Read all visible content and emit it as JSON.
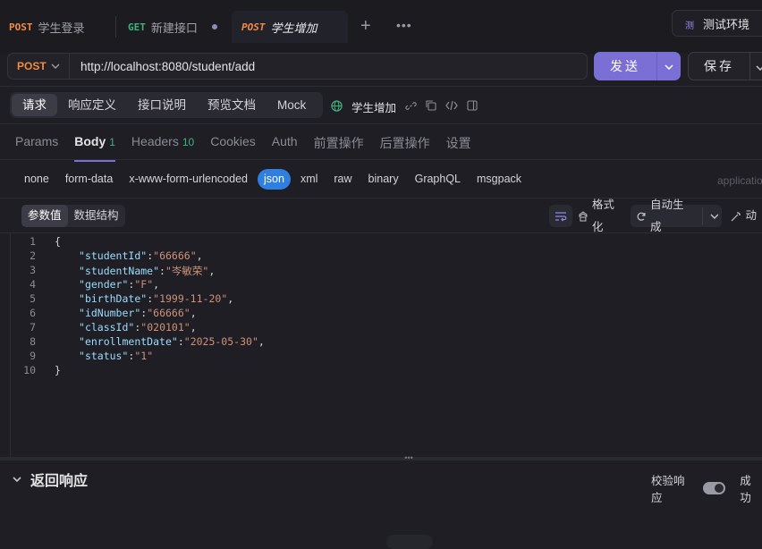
{
  "tabs": [
    {
      "method": "POST",
      "name": "学生登录"
    },
    {
      "method": "GET",
      "name": "新建接口"
    },
    {
      "method": "POST",
      "name": "学生增加"
    }
  ],
  "tab_new_icon": "plus-icon",
  "tab_more_icon": "ellipsis-icon",
  "environment": {
    "badge": "测",
    "label": "测试环境"
  },
  "request": {
    "method": "POST",
    "url": "http://localhost:8080/student/add",
    "send_label": "发送",
    "save_label": "保存"
  },
  "subnav": [
    "请求",
    "响应定义",
    "接口说明",
    "预览文档",
    "Mock"
  ],
  "api_name": "学生增加",
  "param_tabs": [
    {
      "label": "Params",
      "count": ""
    },
    {
      "label": "Body",
      "count": "1"
    },
    {
      "label": "Headers",
      "count": "10"
    },
    {
      "label": "Cookies",
      "count": ""
    },
    {
      "label": "Auth",
      "count": ""
    },
    {
      "label": "前置操作",
      "count": ""
    },
    {
      "label": "后置操作",
      "count": ""
    },
    {
      "label": "设置",
      "count": ""
    }
  ],
  "body_types": [
    "none",
    "form-data",
    "x-www-form-urlencoded",
    "json",
    "xml",
    "raw",
    "binary",
    "GraphQL",
    "msgpack"
  ],
  "active_body_type": "json",
  "content_type": "applicatio",
  "view_toggle": [
    "参数值",
    "数据结构"
  ],
  "toolbar": {
    "format": "格式化",
    "autogen": "自动生成",
    "extra": "动"
  },
  "code": {
    "open": "{",
    "close": "}",
    "fields": [
      {
        "key": "studentId",
        "value": "66666"
      },
      {
        "key": "studentName",
        "value": "岑敏荣"
      },
      {
        "key": "gender",
        "value": "F"
      },
      {
        "key": "birthDate",
        "value": "1999-11-20"
      },
      {
        "key": "idNumber",
        "value": "66666"
      },
      {
        "key": "classId",
        "value": "020101"
      },
      {
        "key": "enrollmentDate",
        "value": "2025-05-30"
      },
      {
        "key": "status",
        "value": "1"
      }
    ]
  },
  "line_numbers": [
    "1",
    "2",
    "3",
    "4",
    "5",
    "6",
    "7",
    "8",
    "9",
    "10"
  ],
  "response": {
    "title": "返回响应",
    "verify_label": "校验响应",
    "verify_on": true,
    "status_cut": "成功"
  }
}
